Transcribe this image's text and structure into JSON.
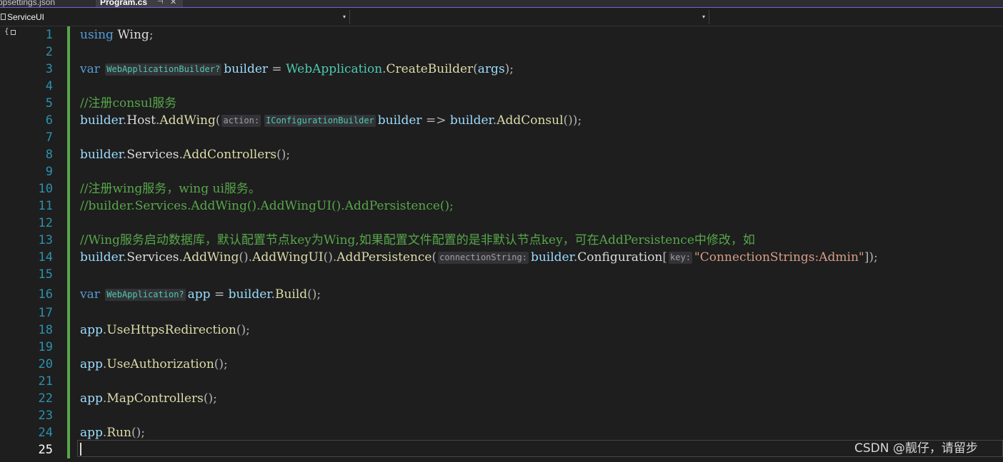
{
  "tabs": [
    {
      "label": "ppsettings.json",
      "active": false
    },
    {
      "label": "Program.cs",
      "active": true,
      "pin_glyph": "⊣",
      "close_glyph": "✕"
    }
  ],
  "navbar": {
    "project": "ServiceUI",
    "member": "",
    "dropdown_glyph": "▾"
  },
  "outline_glyph": "{",
  "line_numbers": [
    "1",
    "2",
    "3",
    "4",
    "5",
    "6",
    "7",
    "8",
    "9",
    "10",
    "11",
    "12",
    "13",
    "14",
    "15",
    "16",
    "17",
    "18",
    "19",
    "20",
    "21",
    "22",
    "23",
    "24",
    "25"
  ],
  "current_line": "25",
  "code": {
    "l1": {
      "kw": "using",
      "ns": "Wing",
      "end": ";"
    },
    "l3": {
      "kw": "var",
      "hint": "WebApplicationBuilder?",
      "ident": "builder",
      "eq": "=",
      "type": "WebApplication",
      "method": "CreateBuilder",
      "arg": "args",
      "end": ");"
    },
    "l5": {
      "comment": "//注册consul服务"
    },
    "l6": {
      "recv": "builder",
      "prop": "Host",
      "method": "AddWing",
      "hint_name": "action:",
      "hint_type": "IConfigurationBuilder",
      "param": "builder",
      "arrow": "=>",
      "recv2": "builder",
      "method2": "AddConsul",
      "end": "());"
    },
    "l8": {
      "recv": "builder",
      "prop": "Services",
      "method": "AddControllers",
      "end": "();"
    },
    "l10": {
      "comment": "//注册wing服务，wing ui服务。"
    },
    "l11": {
      "comment": "//builder.Services.AddWing().AddWingUI().AddPersistence();"
    },
    "l13": {
      "comment": "//Wing服务启动数据库，默认配置节点key为Wing,如果配置文件配置的是非默认节点key，可在AddPersistence中修改，如"
    },
    "l14": {
      "recv": "builder",
      "prop": "Services",
      "m1": "AddWing",
      "m2": "AddWingUI",
      "m3": "AddPersistence",
      "hint1": "connectionString:",
      "recv2": "builder",
      "prop2": "Configuration",
      "hint2": "key:",
      "string": "\"ConnectionStrings:Admin\"",
      "end": "]);"
    },
    "l16": {
      "kw": "var",
      "hint": "WebApplication?",
      "ident": "app",
      "eq": "=",
      "recv": "builder",
      "method": "Build",
      "end": "();"
    },
    "l18": {
      "recv": "app",
      "method": "UseHttpsRedirection",
      "end": "();"
    },
    "l20": {
      "recv": "app",
      "method": "UseAuthorization",
      "end": "();"
    },
    "l22": {
      "recv": "app",
      "method": "MapControllers",
      "end": "();"
    },
    "l24": {
      "recv": "app",
      "method": "Run",
      "end": "();"
    }
  },
  "watermark": "CSDN @靓仔，请留步",
  "colors": {
    "keyword": "#569cd6",
    "type": "#4ec9b0",
    "method": "#dcdcaa",
    "comment": "#57a64a",
    "string": "#d69d85",
    "line_number": "#2b91af",
    "tab_accent": "#7160e8"
  }
}
